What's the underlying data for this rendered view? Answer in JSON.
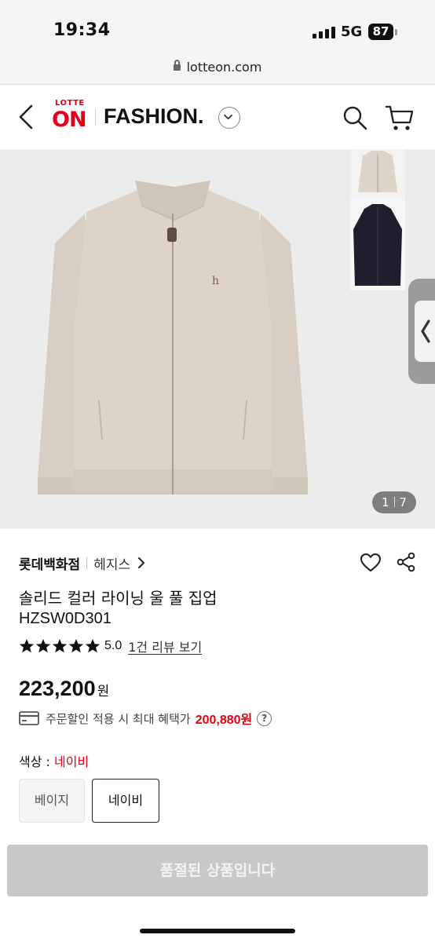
{
  "status_bar": {
    "time": "19:34",
    "network": "5G",
    "battery": "87"
  },
  "browser": {
    "url": "lotteon.com"
  },
  "header": {
    "logo_top": "LOTTE",
    "logo_main": "ON",
    "section": "FASHION."
  },
  "gallery": {
    "current": "1",
    "total": "7"
  },
  "product": {
    "store": "롯데백화점",
    "brand": "헤지스",
    "title": "솔리드 컬러 라이닝 울 풀 집업",
    "code": "HZSW0D301",
    "rating": "5.0",
    "review_link": "1건 리뷰 보기",
    "price": "223,200",
    "currency": "원",
    "benefit_text": "주문할인 적용 시 최대 혜택가",
    "benefit_price": "200,880원",
    "color_label": "색상 :",
    "selected_color": "네이비",
    "options": [
      "베이지",
      "네이비"
    ]
  },
  "cta": {
    "label": "품절된 상품입니다"
  },
  "colors": {
    "accent_red": "#e60012",
    "brand_red": "#e1001a",
    "beige": "#d6cbbf",
    "navy": "#1b1f2e"
  },
  "icons": [
    "back-icon",
    "search-icon",
    "cart-icon",
    "chevron-down-icon",
    "heart-icon",
    "share-icon",
    "card-icon",
    "help-icon",
    "star-icon",
    "lock-icon"
  ]
}
